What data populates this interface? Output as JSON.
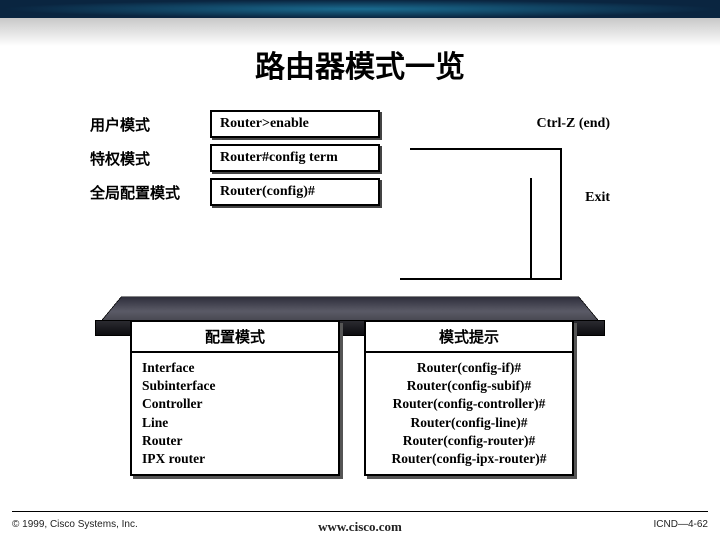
{
  "title": "路由器模式一览",
  "rows": [
    {
      "label": "用户模式",
      "cmd": "Router>enable"
    },
    {
      "label": "特权模式",
      "cmd": "Router#config term"
    },
    {
      "label": "全局配置模式",
      "cmd": "Router(config)#"
    }
  ],
  "side": {
    "ctrlz": "Ctrl-Z (end)",
    "exit": "Exit"
  },
  "bottom": {
    "left_header": "配置模式",
    "right_header": "模式提示",
    "left_items": [
      "Interface",
      "Subinterface",
      "Controller",
      "Line",
      "Router",
      "IPX router"
    ],
    "right_items": [
      "Router(config-if)#",
      "Router(config-subif)#",
      "Router(config-controller)#",
      "Router(config-line)#",
      "Router(config-router)#",
      "Router(config-ipx-router)#"
    ]
  },
  "footer": {
    "left": "© 1999, Cisco Systems, Inc.",
    "center": "www.cisco.com",
    "right": "ICND—4-62"
  }
}
